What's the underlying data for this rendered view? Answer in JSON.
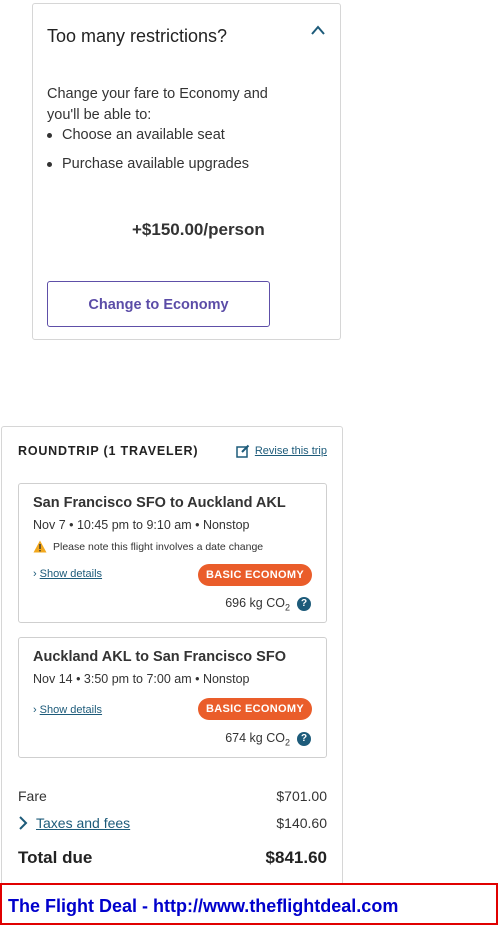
{
  "upsell": {
    "title": "Too many restrictions?",
    "description": "Change your fare to Economy and you'll be able to:",
    "benefits": [
      "Choose an available seat",
      "Purchase available upgrades"
    ],
    "price": "+$150.00/person",
    "button_label": "Change to Economy"
  },
  "trip": {
    "heading": "ROUNDTRIP (1 TRAVELER)",
    "revise_label": "Revise this trip",
    "segments": [
      {
        "route": "San Francisco SFO to Auckland AKL",
        "times": "Nov 7 • 10:45 pm to 9:10 am • Nonstop",
        "warning": "Please note this flight involves a date change",
        "details_label": "Show details",
        "fare_class": "BASIC ECONOMY",
        "co2_value": "696 kg CO",
        "co2_sub": "2"
      },
      {
        "route": "Auckland AKL to San Francisco SFO",
        "times": "Nov 14 • 3:50 pm to 7:00 am • Nonstop",
        "details_label": "Show details",
        "fare_class": "BASIC ECONOMY",
        "co2_value": "674 kg CO",
        "co2_sub": "2"
      }
    ],
    "fare_label": "Fare",
    "fare_value": "$701.00",
    "taxes_label": "Taxes and fees",
    "taxes_value": "$140.60",
    "total_label": "Total due",
    "total_value": "$841.60"
  },
  "banner": {
    "text": "The Flight Deal - http://www.theflightdeal.com"
  },
  "colors": {
    "accent_purple": "#5b4ca7",
    "link_teal": "#1d5b7a",
    "badge_orange": "#ea5d2a",
    "banner_red": "#e00000",
    "banner_blue": "#0000cc"
  },
  "icons": [
    "chevron-up-icon",
    "edit-icon",
    "warning-icon",
    "chevron-right-icon",
    "help-icon"
  ]
}
